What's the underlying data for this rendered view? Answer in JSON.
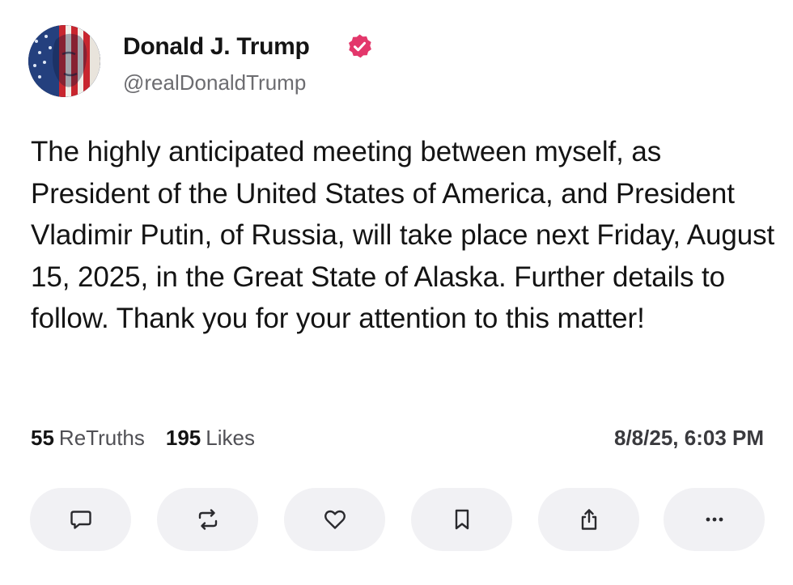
{
  "author": {
    "display_name": "Donald J. Trump",
    "handle": "@realDonaldTrump",
    "verified": true,
    "verified_badge_color": "#e3376b",
    "avatar_icon": "flag-portrait-avatar"
  },
  "post": {
    "text": "The highly anticipated meeting between myself, as President of the United States of America, and President Vladimir Putin, of Russia, will take place next Friday, August 15, 2025, in the Great State of Alaska. Further details to follow. Thank you for your attention to this matter!"
  },
  "stats": {
    "retruths_count": "55",
    "retruths_label": "ReTruths",
    "likes_count": "195",
    "likes_label": "Likes"
  },
  "timestamp": "8/8/25, 6:03 PM",
  "actions": [
    {
      "icon": "comment-icon"
    },
    {
      "icon": "retruth-icon"
    },
    {
      "icon": "heart-icon"
    },
    {
      "icon": "bookmark-icon"
    },
    {
      "icon": "share-icon"
    },
    {
      "icon": "more-icon"
    }
  ],
  "colors": {
    "text": "#141414",
    "secondary_text": "#6c6c70",
    "action_button_bg": "#f1f1f4",
    "icon_stroke": "#2a2a2e"
  }
}
